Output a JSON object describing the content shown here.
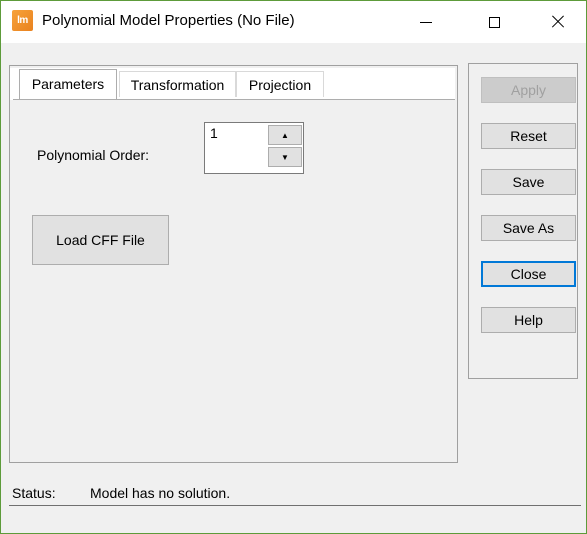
{
  "window": {
    "title": "Polynomial Model Properties (No File)",
    "app_icon_text": "lm",
    "accent_color": "#5d9b3a"
  },
  "tabs": [
    {
      "label": "Parameters",
      "active": true
    },
    {
      "label": "Transformation",
      "active": false
    },
    {
      "label": "Projection",
      "active": false
    }
  ],
  "parameters": {
    "order_label": "Polynomial Order:",
    "order_value": "1",
    "spin_up_icon": "up-arrow",
    "spin_down_icon": "down-arrow",
    "load_button": "Load CFF File"
  },
  "buttons": {
    "apply": "Apply",
    "reset": "Reset",
    "save": "Save",
    "save_as": "Save As",
    "close": "Close",
    "help": "Help"
  },
  "status": {
    "label": "Status:",
    "text": "Model has no solution."
  }
}
